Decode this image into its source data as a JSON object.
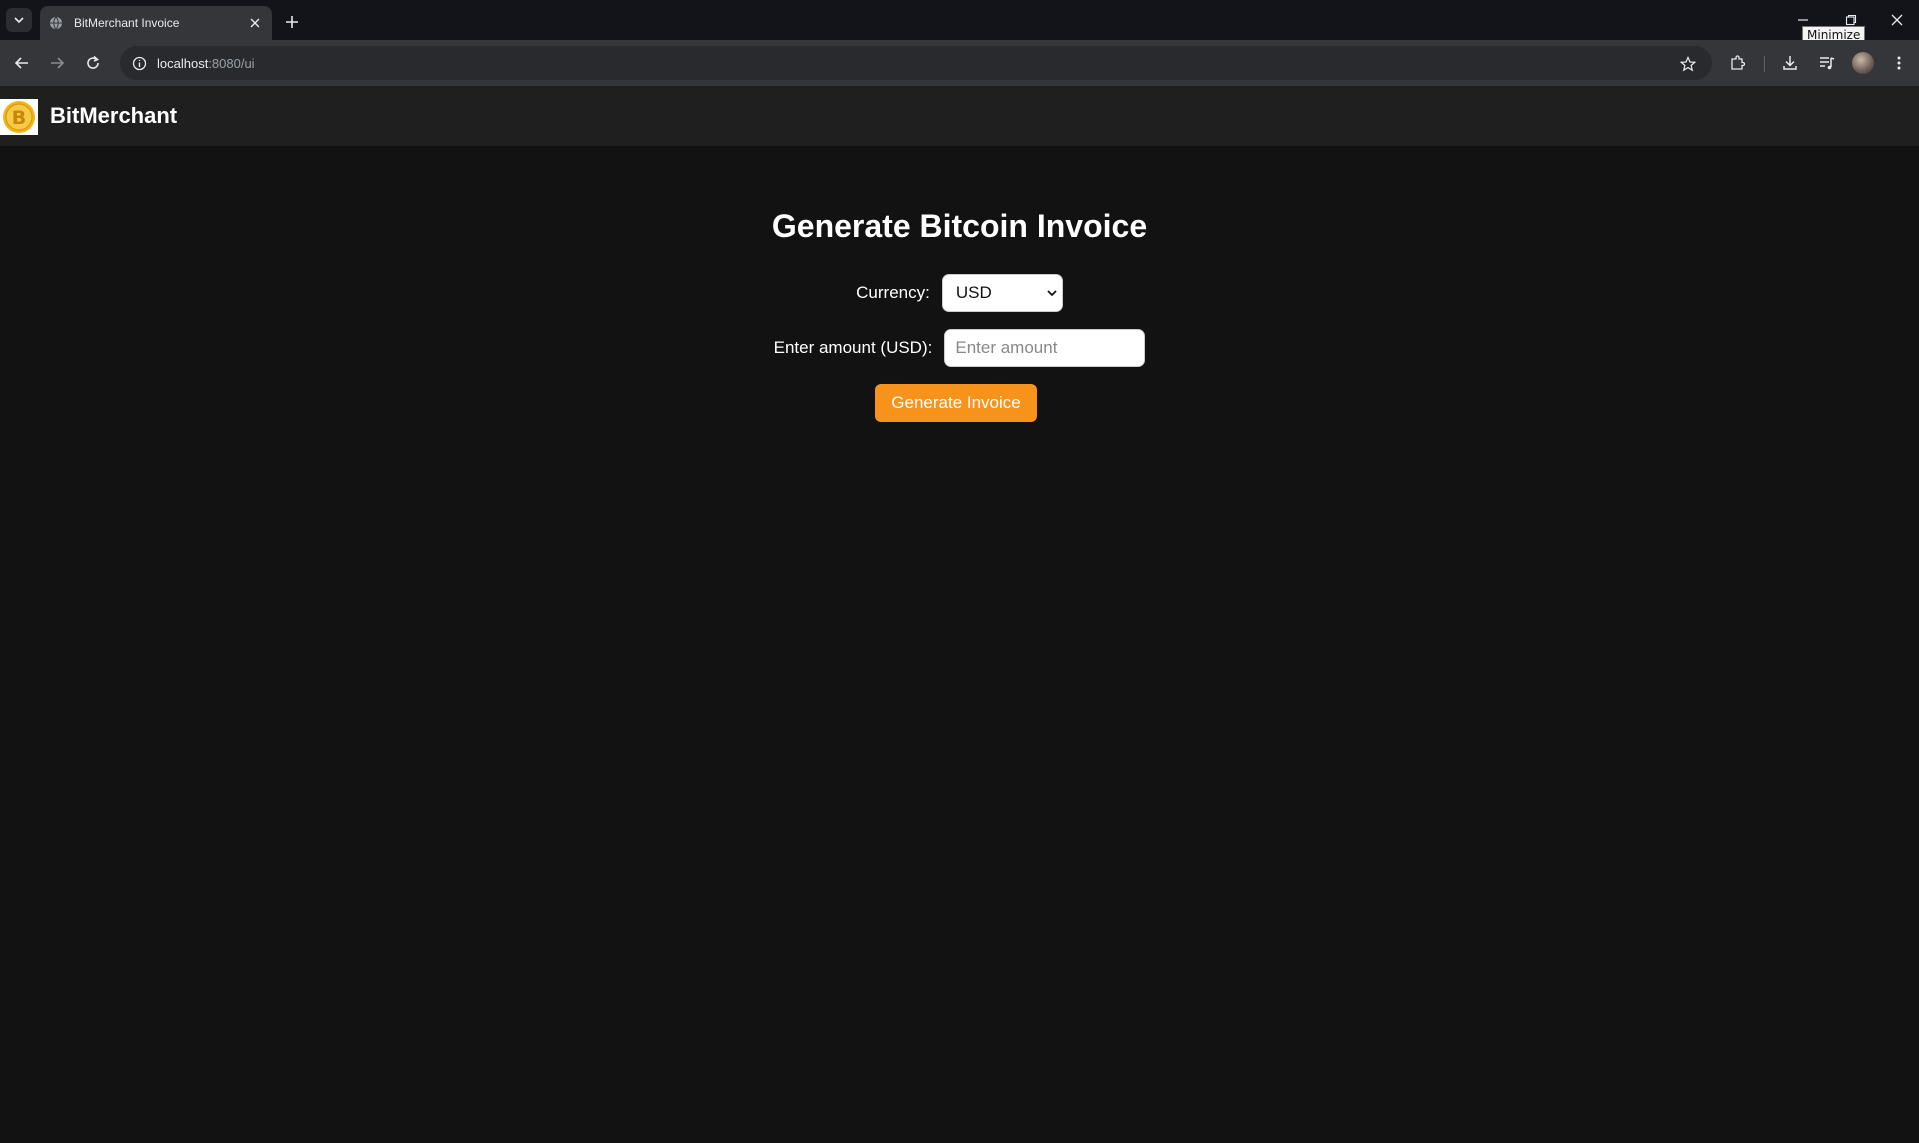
{
  "browser": {
    "tab_title": "BitMerchant Invoice",
    "url_host": "localhost",
    "url_path": ":8080/ui",
    "tooltip": "Minimize"
  },
  "header": {
    "brand": "BitMerchant"
  },
  "main": {
    "title": "Generate Bitcoin Invoice",
    "currency_label": "Currency:",
    "currency_value": "USD",
    "amount_label": "Enter amount (USD):",
    "amount_placeholder": "Enter amount",
    "generate_label": "Generate Invoice"
  },
  "colors": {
    "accent": "#f7931a",
    "background": "#121212",
    "header_bg": "#1f1f1f"
  }
}
